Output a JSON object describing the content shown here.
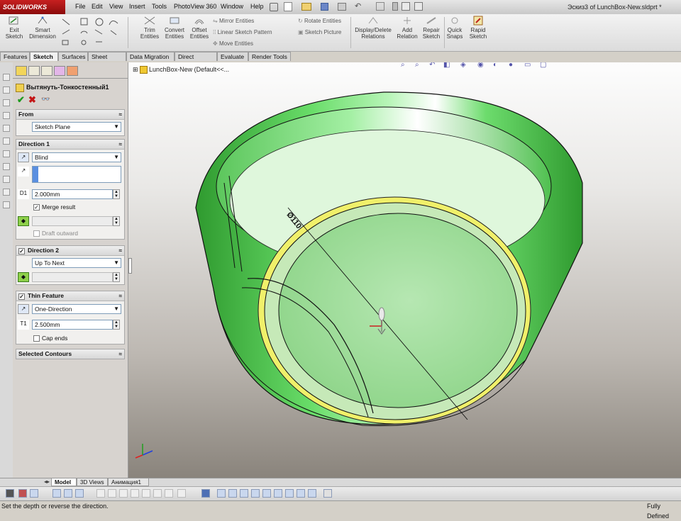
{
  "app": {
    "logo_text": "SOLIDWORKS",
    "document_title": "Эскиз3 of LunchBox-New.sldprt *"
  },
  "menu": [
    "File",
    "Edit",
    "View",
    "Insert",
    "Tools",
    "PhotoView 360",
    "Window",
    "Help"
  ],
  "ribbon": {
    "exit_sketch": "Exit Sketch",
    "smart_dimension": "Smart Dimension",
    "trim_entities": "Trim Entities",
    "convert_entities": "Convert Entities",
    "offset_entities": "Offset Entities",
    "mirror_entities": "Mirror Entities",
    "linear_sketch_pattern": "Linear Sketch Pattern",
    "move_entities": "Move Entities",
    "rotate_entities": "Rotate Entities",
    "sketch_picture": "Sketch Picture",
    "display_delete_relations": "Display/Delete Relations",
    "add_relation": "Add Relation",
    "repair_sketch": "Repair Sketch",
    "quick_snaps": "Quick Snaps",
    "rapid_sketch": "Rapid Sketch"
  },
  "tabs": [
    "Features",
    "Sketch",
    "Surfaces",
    "Sheet Metal",
    "Data Migration",
    "Direct Editing",
    "Evaluate",
    "Render Tools"
  ],
  "active_tab": "Sketch",
  "property_manager": {
    "feature_name": "Вытянуть-Тонкостенный1",
    "from": {
      "header": "From",
      "value": "Sketch Plane"
    },
    "direction1": {
      "header": "Direction 1",
      "end_condition": "Blind",
      "depth": "2.000mm",
      "merge_result_label": "Merge result",
      "merge_result_checked": true,
      "draft_outward_label": "Draft outward",
      "draft_outward_checked": false
    },
    "direction2": {
      "header": "Direction 2",
      "checked": true,
      "end_condition": "Up To Next"
    },
    "thin_feature": {
      "header": "Thin Feature",
      "checked": true,
      "type": "One-Direction",
      "thickness": "2.500mm",
      "cap_ends_label": "Cap ends",
      "cap_ends_checked": false
    },
    "selected_contours": {
      "header": "Selected Contours"
    }
  },
  "feature_tree": {
    "root": "LunchBox-New  (Default<<..."
  },
  "dimension_label": "Ø110",
  "bottom_tabs": [
    "Model",
    "3D Views",
    "Анимация1"
  ],
  "active_bottom_tab": "Model",
  "status": {
    "message": "Set the depth or reverse the direction.",
    "state": "Fully Defined"
  },
  "colors": {
    "part_green": "#5ed45e",
    "highlight_yellow": "#f4f46a",
    "accent_blue": "#3a6fc4",
    "logo_red": "#b01515"
  }
}
